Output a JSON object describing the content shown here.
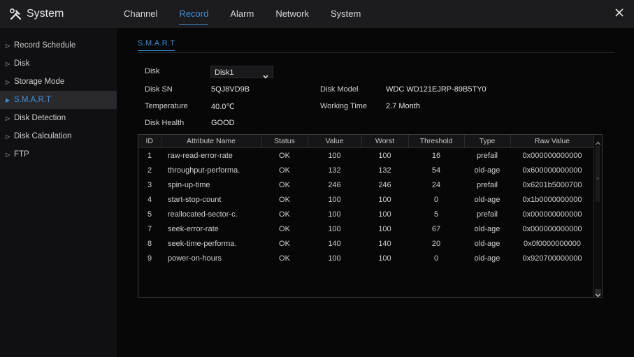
{
  "app": {
    "title": "System"
  },
  "tabs": [
    {
      "label": "Channel",
      "active": false
    },
    {
      "label": "Record",
      "active": true
    },
    {
      "label": "Alarm",
      "active": false
    },
    {
      "label": "Network",
      "active": false
    },
    {
      "label": "System",
      "active": false
    }
  ],
  "sidebar": {
    "items": [
      {
        "label": "Record Schedule",
        "active": false
      },
      {
        "label": "Disk",
        "active": false
      },
      {
        "label": "Storage Mode",
        "active": false
      },
      {
        "label": "S.M.A.R.T",
        "active": true
      },
      {
        "label": "Disk Detection",
        "active": false
      },
      {
        "label": "Disk Calculation",
        "active": false
      },
      {
        "label": "FTP",
        "active": false
      }
    ]
  },
  "subtab": {
    "label": "S.M.A.R.T"
  },
  "info": {
    "disk_label": "Disk",
    "disk_value": "Disk1",
    "disk_sn_label": "Disk SN",
    "disk_sn_value": "5QJ8VD9B",
    "disk_model_label": "Disk Model",
    "disk_model_value": "WDC WD121EJRP-89B5TY0",
    "temperature_label": "Temperature",
    "temperature_value": "40.0℃",
    "working_time_label": "Working Time",
    "working_time_value": "2.7 Month",
    "disk_health_label": "Disk Health",
    "disk_health_value": "GOOD"
  },
  "table": {
    "headers": [
      "ID",
      "Attribute Name",
      "Status",
      "Value",
      "Worst",
      "Threshold",
      "Type",
      "Raw Value"
    ],
    "rows": [
      [
        "1",
        "raw-read-error-rate",
        "OK",
        "100",
        "100",
        "16",
        "prefail",
        "0x000000000000"
      ],
      [
        "2",
        "throughput-performa.",
        "OK",
        "132",
        "132",
        "54",
        "old-age",
        "0x600000000000"
      ],
      [
        "3",
        "spin-up-time",
        "OK",
        "246",
        "246",
        "24",
        "prefail",
        "0x6201b5000700"
      ],
      [
        "4",
        "start-stop-count",
        "OK",
        "100",
        "100",
        "0",
        "old-age",
        "0x1b0000000000"
      ],
      [
        "5",
        "reallocated-sector-c.",
        "OK",
        "100",
        "100",
        "5",
        "prefail",
        "0x000000000000"
      ],
      [
        "7",
        "seek-error-rate",
        "OK",
        "100",
        "100",
        "67",
        "old-age",
        "0x000000000000"
      ],
      [
        "8",
        "seek-time-performa.",
        "OK",
        "140",
        "140",
        "20",
        "old-age",
        "0x0f0000000000"
      ],
      [
        "9",
        "power-on-hours",
        "OK",
        "100",
        "100",
        "0",
        "old-age",
        "0x920700000000"
      ]
    ]
  },
  "colors": {
    "accent": "#3d8fd8"
  }
}
